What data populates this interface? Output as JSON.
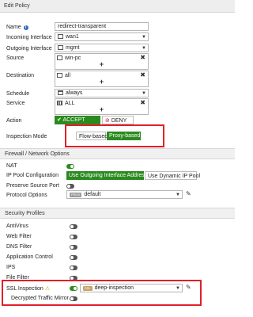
{
  "window": {
    "title": "Edit Policy"
  },
  "policy": {
    "name": {
      "label": "Name",
      "value": "redirect-transparent"
    },
    "incoming": {
      "label": "Incoming Interface",
      "value": "wan1"
    },
    "outgoing": {
      "label": "Outgoing Interface",
      "value": "mgmt"
    },
    "source": {
      "label": "Source",
      "value": "win-pc"
    },
    "destination": {
      "label": "Destination",
      "value": "all"
    },
    "schedule": {
      "label": "Schedule",
      "value": "always"
    },
    "service": {
      "label": "Service",
      "value": "ALL"
    },
    "action": {
      "label": "Action",
      "accept": "ACCEPT",
      "deny": "DENY",
      "selected": "ACCEPT"
    },
    "inspection_mode": {
      "label": "Inspection Mode",
      "flow": "Flow-based",
      "proxy": "Proxy-based",
      "selected": "Proxy-based"
    }
  },
  "firewall_network": {
    "section_title": "Firewall / Network Options",
    "nat": {
      "label": "NAT",
      "enabled": true
    },
    "ip_pool": {
      "label": "IP Pool Configuration",
      "use_outgoing": "Use Outgoing Interface Address",
      "use_dynamic": "Use Dynamic IP Pool",
      "selected": "Use Outgoing Interface Address"
    },
    "preserve_source_port": {
      "label": "Preserve Source Port",
      "enabled": false
    },
    "protocol_options": {
      "label": "Protocol Options",
      "badge": "PROX",
      "value": "default"
    }
  },
  "security_profiles": {
    "section_title": "Security Profiles",
    "items": [
      {
        "label": "AntiVirus",
        "enabled": false
      },
      {
        "label": "Web Filter",
        "enabled": false
      },
      {
        "label": "DNS Filter",
        "enabled": false
      },
      {
        "label": "Application Control",
        "enabled": false
      },
      {
        "label": "IPS",
        "enabled": false
      },
      {
        "label": "File Filter",
        "enabled": false
      }
    ],
    "ssl_inspection": {
      "label": "SSL Inspection",
      "badge": "SSL",
      "value": "deep-inspection",
      "enabled": true
    },
    "decrypted_mirror": {
      "label": "Decrypted Traffic Mirror",
      "enabled": false
    }
  },
  "colors": {
    "accent_green": "#2b8a1f",
    "highlight_red": "#e0202a",
    "info_blue": "#2f6db5",
    "warning_orange": "#e69a00"
  }
}
